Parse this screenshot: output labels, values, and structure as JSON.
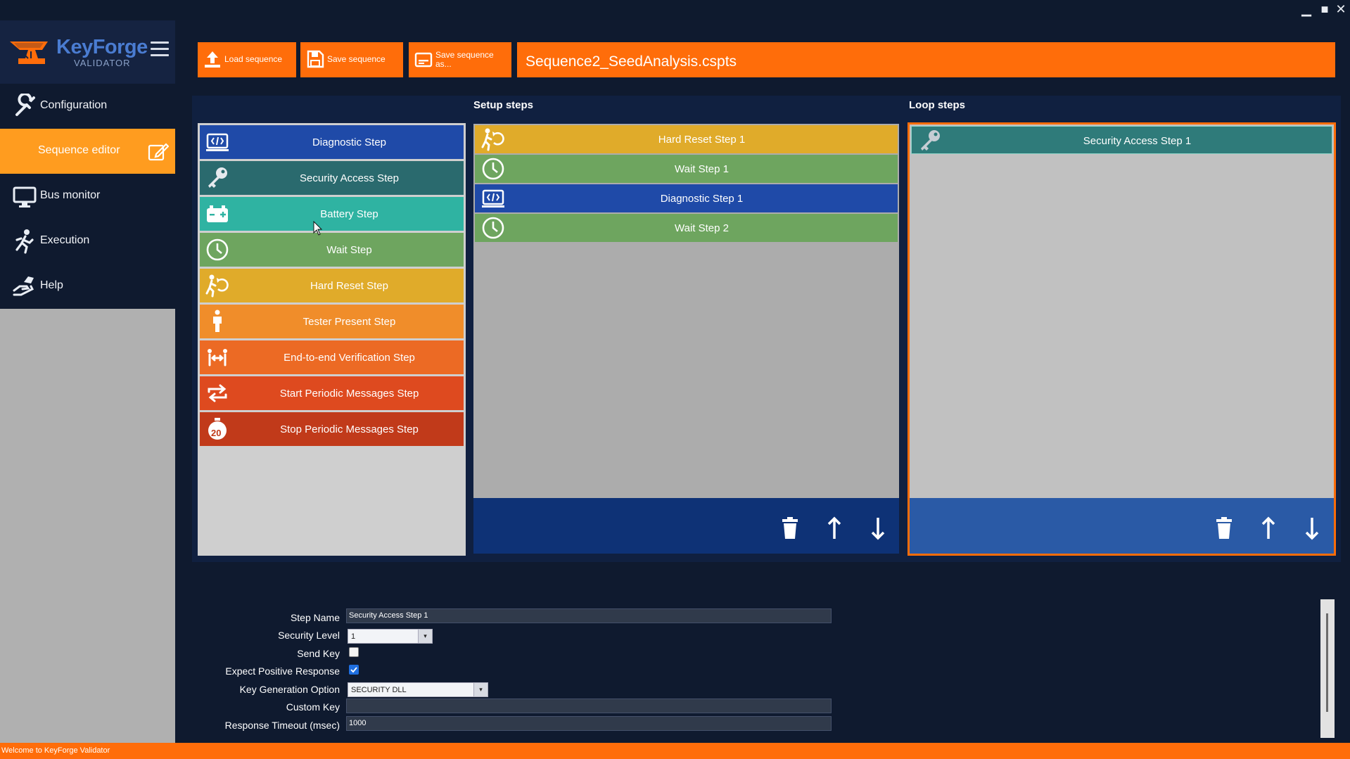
{
  "app": {
    "logo_main": "KeyForge",
    "logo_sub": "VALIDATOR",
    "colors": {
      "accent": "#ff6d0a",
      "active_nav": "#ff9c1f",
      "navy": "#0f1a2f",
      "action_bar": "#0e3276"
    }
  },
  "window_controls": {
    "minimize": "▁",
    "maximize": "■",
    "close": "✕"
  },
  "nav": {
    "items": [
      {
        "label": "Configuration",
        "icon": "wrench-icon"
      },
      {
        "label": "Sequence editor",
        "icon": "edit-icon",
        "active": true
      },
      {
        "label": "Bus monitor",
        "icon": "monitor-icon"
      },
      {
        "label": "Execution",
        "icon": "running-person-icon"
      },
      {
        "label": "Help",
        "icon": "helping-hand-icon"
      }
    ]
  },
  "toolbar": {
    "load": "Load sequence",
    "save": "Save sequence",
    "save_as_line1": "Save sequence",
    "save_as_line2": "as...",
    "filename": "Sequence2_SeedAnalysis.cspts"
  },
  "columns": {
    "setup": "Setup steps",
    "loop": "Loop steps"
  },
  "palette": [
    {
      "label": "Diagnostic Step",
      "icon": "diagnostic-icon",
      "color": "#1f4aa8"
    },
    {
      "label": "Security Access Step",
      "icon": "key-icon",
      "color": "#2a6a6e"
    },
    {
      "label": "Battery Step",
      "icon": "battery-icon",
      "color": "#2fb3a2"
    },
    {
      "label": "Wait Step",
      "icon": "clock-icon",
      "color": "#6ea55f"
    },
    {
      "label": "Hard Reset Step",
      "icon": "reset-person-icon",
      "color": "#e0ab2a"
    },
    {
      "label": "Tester Present Step",
      "icon": "person-icon",
      "color": "#f08d2a"
    },
    {
      "label": "End-to-end Verification Step",
      "icon": "verification-icon",
      "color": "#ec6a24"
    },
    {
      "label": "Start Periodic Messages Step",
      "icon": "repeat-icon",
      "color": "#de4a1f"
    },
    {
      "label": "Stop Periodic Messages Step",
      "icon": "stopwatch-icon",
      "color": "#c13a1a",
      "badge": "20"
    }
  ],
  "setup_steps": [
    {
      "label": "Hard Reset Step 1",
      "icon": "reset-person-icon",
      "color": "#e0ab2a"
    },
    {
      "label": "Wait Step 1",
      "icon": "clock-icon",
      "color": "#6ea55f"
    },
    {
      "label": "Diagnostic Step 1",
      "icon": "diagnostic-icon",
      "color": "#1f4aa8"
    },
    {
      "label": "Wait Step 2",
      "icon": "clock-icon",
      "color": "#6ea55f"
    }
  ],
  "loop_steps": [
    {
      "label": "Security Access Step 1",
      "icon": "key-icon",
      "color": "#2f7b7a"
    }
  ],
  "properties": {
    "step_name_label": "Step Name",
    "step_name_value": "Security Access Step 1",
    "security_level_label": "Security Level",
    "security_level_value": "1",
    "send_key_label": "Send Key",
    "send_key_checked": false,
    "expect_positive_label": "Expect Positive Response",
    "expect_positive_checked": true,
    "key_gen_label": "Key Generation Option",
    "key_gen_value": "SECURITY DLL",
    "custom_key_label": "Custom Key",
    "custom_key_value": "",
    "timeout_label": "Response Timeout (msec)",
    "timeout_value": "1000"
  },
  "status": {
    "text": "Welcome to KeyForge Validator"
  }
}
